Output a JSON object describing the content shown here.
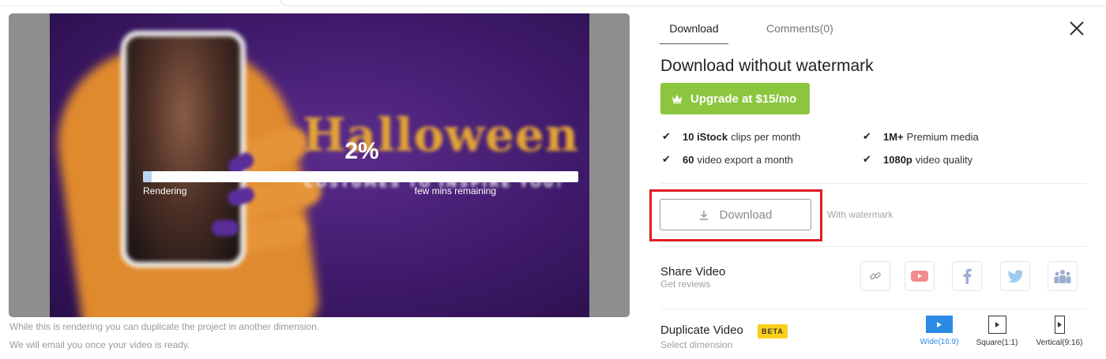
{
  "preview": {
    "video_text": "Halloween",
    "video_subtext": "COSTUMES TO INSPIRE YOU!",
    "progress_percent_label": "2%",
    "progress_fraction": 0.02,
    "rendering_label": "Rendering",
    "remaining_label": "few mins remaining",
    "note_1": "While this is rendering you can duplicate the project in another dimension.",
    "note_2": "We will email you once your video is ready."
  },
  "tabs": [
    {
      "label": "Download",
      "active": true
    },
    {
      "label": "Comments(0)",
      "active": false
    }
  ],
  "panel": {
    "title": "Download without watermark",
    "upgrade_label": "Upgrade at $15/mo",
    "features": [
      {
        "bold": "10 iStock",
        "rest": "clips per month"
      },
      {
        "bold": "1M+",
        "rest": "Premium media"
      },
      {
        "bold": "60",
        "rest": "video export a month"
      },
      {
        "bold": "1080p",
        "rest": "video quality"
      }
    ],
    "download_label": "Download",
    "watermark_note": "With watermark"
  },
  "share": {
    "title": "Share Video",
    "subtitle": "Get reviews",
    "icons": [
      "link-icon",
      "youtube-icon",
      "facebook-icon",
      "twitter-icon",
      "team-icon"
    ]
  },
  "duplicate": {
    "title": "Duplicate Video",
    "badge": "BETA",
    "subtitle": "Select dimension",
    "options": [
      {
        "label": "Wide(16:9)",
        "active": true
      },
      {
        "label": "Square(1:1)",
        "active": false
      },
      {
        "label": "Vertical(9:16)",
        "active": false
      }
    ]
  },
  "colors": {
    "accent_green": "#8cc63f",
    "highlight_red": "#e01b24",
    "active_blue": "#2a8be6",
    "beta_yellow": "#f8cf1a"
  }
}
